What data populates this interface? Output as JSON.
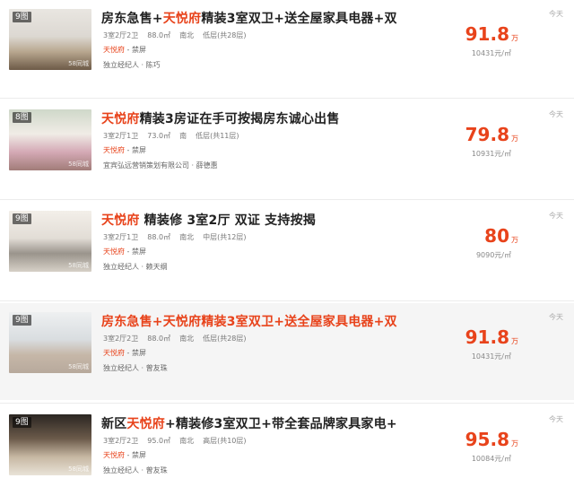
{
  "listings": [
    {
      "badge": "9图",
      "title_parts": [
        [
          "房东急售+",
          false
        ],
        [
          "天悦府",
          true
        ],
        [
          "精装3室双卫+送全屋家具电器+双",
          false
        ]
      ],
      "meta": [
        "3室2厅2卫",
        "88.0㎡",
        "南北",
        "低层(共28层)"
      ],
      "community": [
        "天悦府",
        " - 禁屏"
      ],
      "agent": "独立经纪人 · 陈巧",
      "price": "91.8",
      "price_unit": "万",
      "unit_price": "10431元/㎡",
      "date": "今天"
    },
    {
      "badge": "8图",
      "title_parts": [
        [
          "天悦府",
          true
        ],
        [
          "精装3房证在手可按揭房东诚心出售",
          false
        ]
      ],
      "meta": [
        "3室2厅1卫",
        "73.0㎡",
        "南",
        "低层(共11层)"
      ],
      "community": [
        "天悦府",
        " - 禁屏"
      ],
      "agent": "宜宾弘远营销策划有限公司 · 薛德惠",
      "price": "79.8",
      "price_unit": "万",
      "unit_price": "10931元/㎡",
      "date": "今天"
    },
    {
      "badge": "9图",
      "title_parts": [
        [
          "天悦府",
          true
        ],
        [
          " 精装修 3室2厅 双证 支持按揭",
          false
        ]
      ],
      "meta": [
        "3室2厅1卫",
        "88.0㎡",
        "南北",
        "中层(共12层)"
      ],
      "community": [
        "天悦府",
        " - 禁屏"
      ],
      "agent": "独立经纪人 · 赖天纲",
      "price": "80",
      "price_unit": "万",
      "unit_price": "9090元/㎡",
      "date": "今天"
    },
    {
      "badge": "9图",
      "title_parts": [
        [
          "房东急售+天悦府精装3室双卫+送全屋家具电器+双",
          true
        ]
      ],
      "meta": [
        "3室2厅2卫",
        "88.0㎡",
        "南北",
        "低层(共28层)"
      ],
      "community": [
        "天悦府",
        " - 禁屏"
      ],
      "agent": "独立经纪人 · 曾友珠",
      "price": "91.8",
      "price_unit": "万",
      "unit_price": "10431元/㎡",
      "date": "今天"
    },
    {
      "badge": "9图",
      "title_parts": [
        [
          "新区",
          false
        ],
        [
          "天悦府",
          true
        ],
        [
          "+精装修3室双卫+带全套品牌家具家电+",
          false
        ]
      ],
      "meta": [
        "3室2厅2卫",
        "95.0㎡",
        "南北",
        "高层(共10层)"
      ],
      "community": [
        "天悦府",
        " - 禁屏"
      ],
      "agent": "独立经纪人 · 曾友珠",
      "price": "95.8",
      "price_unit": "万",
      "unit_price": "10084元/㎡",
      "date": "今天"
    }
  ],
  "watermark": "58同城",
  "colors": {
    "accent": "#e8431b",
    "highlight_row": "#f5f5f5"
  }
}
